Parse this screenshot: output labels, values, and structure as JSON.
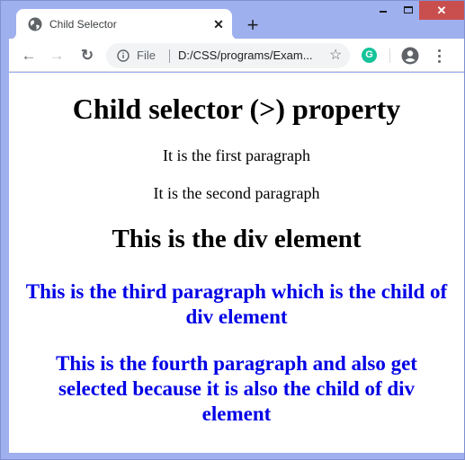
{
  "browser": {
    "tab": {
      "title": "Child Selector",
      "favicon": "globe-icon",
      "close_glyph": "✕"
    },
    "new_tab_glyph": "+",
    "window_controls": {
      "minimize": "minimize-icon",
      "maximize": "maximize-icon",
      "close_glyph": "✕",
      "close_color": "#c94f4f"
    },
    "toolbar": {
      "back_glyph": "←",
      "forward_glyph": "→",
      "reload_glyph": "↻",
      "omnibox": {
        "scheme_label": "File",
        "url": "D:/CSS/programs/Exam...",
        "star_glyph": "☆"
      },
      "extension": {
        "name": "Grammarly",
        "glyph": "G",
        "color": "#15c39a"
      },
      "profile_icon": "account-circle-icon",
      "menu_icon": "more-vert-icon"
    },
    "frame_color": "#9fb0ee"
  },
  "page": {
    "heading": "Child selector (>) property",
    "paragraphs": [
      "It is the first paragraph",
      "It is the second paragraph"
    ],
    "div": {
      "heading": "This is the div element",
      "child_paragraphs": [
        "This is the third paragraph which is the child of div element",
        "This is the fourth paragraph and also get selected because it is also the child of div element"
      ],
      "child_color": "#0000e6"
    }
  }
}
